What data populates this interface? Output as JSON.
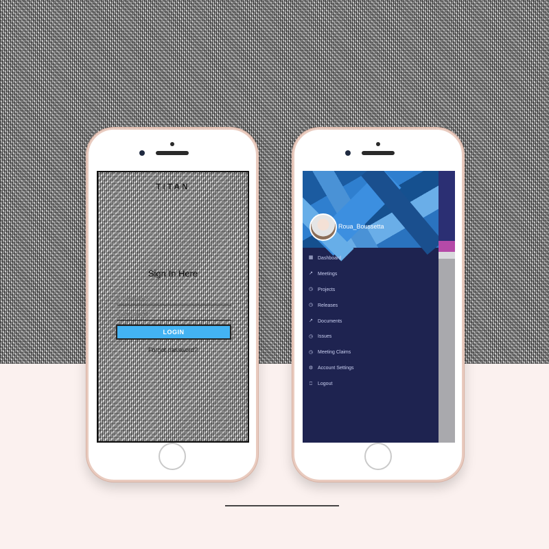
{
  "login": {
    "app_title": "TITAN",
    "heading": "Sign In Here",
    "username_placeholder": "Username",
    "password_placeholder": "Password",
    "login_button": "LOGIN",
    "forgot_link": "Forgot password?"
  },
  "drawer": {
    "user_name": "Roua_Boussetta",
    "items": [
      {
        "label": "Dashboard",
        "icon": "grid-icon"
      },
      {
        "label": "Meetings",
        "icon": "trend-icon"
      },
      {
        "label": "Projects",
        "icon": "clock-icon"
      },
      {
        "label": "Releases",
        "icon": "clock-icon"
      },
      {
        "label": "Documents",
        "icon": "trend-icon"
      },
      {
        "label": "Issues",
        "icon": "clock-icon"
      },
      {
        "label": "Meeting Claims",
        "icon": "clock-icon"
      },
      {
        "label": "Account Settings",
        "icon": "gear-icon"
      },
      {
        "label": "Logout",
        "icon": "logout-icon"
      }
    ]
  },
  "colors": {
    "accent": "#43b3f3",
    "drawer_bg": "#1e2350",
    "menu_text": "#c9cff0"
  }
}
